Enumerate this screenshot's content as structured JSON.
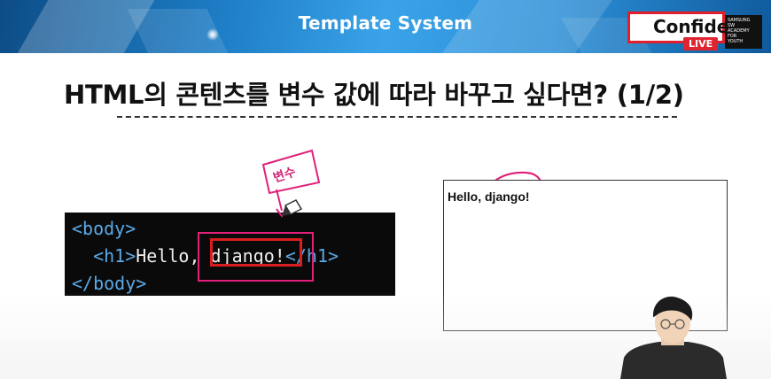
{
  "header": {
    "title": "Template System",
    "badge_text": "Confiden",
    "live_label": "LIVE",
    "brand_lines": [
      "SAMSUNG",
      "SW",
      "ACADEMY",
      "FOR",
      "YOUTH"
    ]
  },
  "slide": {
    "title": "HTML의 콘텐츠를 변수 값에 따라 바꾸고 싶다면? (1/2)",
    "code_lines": [
      {
        "tag_open": "<body>",
        "text": "",
        "tag_close": ""
      },
      {
        "tag_open": "<h1>",
        "text": "Hello, django!",
        "tag_close": "</h1>"
      },
      {
        "tag_open": "</body>",
        "text": "",
        "tag_close": ""
      }
    ],
    "annotation_label": "변수",
    "preview_text": "Hello, django!"
  },
  "colors": {
    "header_blue": "#1d7cc4",
    "code_bg": "#0a0a0a",
    "tag_blue": "#5aa9e6",
    "annotation_pink": "#e0207a",
    "highlight_red": "#d81e1e",
    "live_red": "#e02532"
  }
}
